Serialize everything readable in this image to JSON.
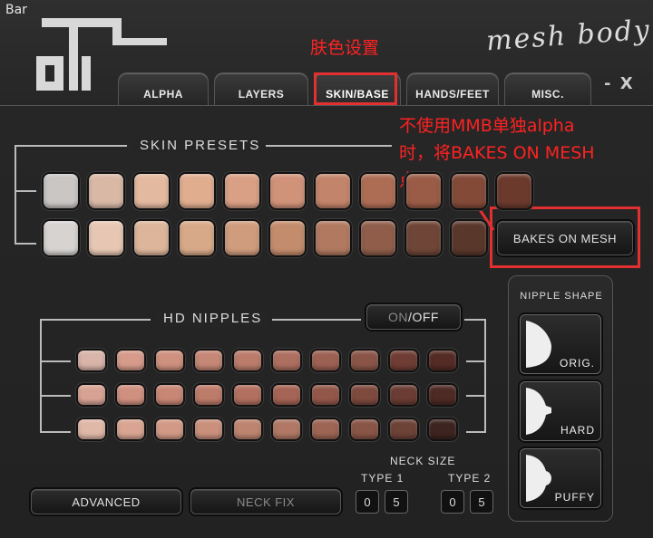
{
  "window": {
    "title": "Bar"
  },
  "brand": {
    "script_text": "mesh body"
  },
  "tabs": [
    {
      "label": "ALPHA"
    },
    {
      "label": "LAYERS"
    },
    {
      "label": "SKIN/BASE"
    },
    {
      "label": "HANDS/FEET"
    },
    {
      "label": "MISC."
    }
  ],
  "window_controls": {
    "minimize": "-",
    "close": "X"
  },
  "annotations": {
    "tab_note": "肤色设置",
    "bom_note_line1": "不使用MMB单独alpha",
    "bom_note_line2": "时，将BAKES ON MESH",
    "bom_note_line3": "点亮",
    "color": "#e23030"
  },
  "skin_presets": {
    "label": "SKIN PRESETS",
    "row1": [
      "#c9c6c4",
      "#d9b8a6",
      "#e3b99f",
      "#e0ad8f",
      "#d9a085",
      "#d09279",
      "#c2846a",
      "#ad6d55",
      "#9a5c46",
      "#834a38",
      "#6b3a2c"
    ],
    "row2": [
      "#d6d3d1",
      "#e7c7b4",
      "#dcb59b",
      "#d7a988",
      "#cf9c7d",
      "#c38c6d",
      "#b07960",
      "#8f5d4a",
      "#6e4536",
      "#5a372b"
    ],
    "bakes_on_mesh_label": "BAKES ON MESH"
  },
  "hd_nipples": {
    "label": "HD NIPPLES",
    "toggle_on": "ON",
    "toggle_sep": "/",
    "toggle_off": "OFF",
    "rows": [
      [
        "#d9b4a8",
        "#d69b8a",
        "#cf917f",
        "#c58776",
        "#bb7c6c",
        "#ad6f60",
        "#9c6153",
        "#8a5548",
        "#6f3d33",
        "#552b25"
      ],
      [
        "#d7a294",
        "#cf9080",
        "#c88675",
        "#bd7b6a",
        "#b27060",
        "#a56455",
        "#93574a",
        "#7e4a3e",
        "#6a3c33",
        "#4e2a24"
      ],
      [
        "#e0b8a8",
        "#d9a592",
        "#d29a86",
        "#c9907c",
        "#bd8470",
        "#b07865",
        "#9c6554",
        "#885546",
        "#6d4237",
        "#3d2420"
      ]
    ]
  },
  "nipple_shape": {
    "label": "NIPPLE SHAPE",
    "options": [
      "ORIG.",
      "HARD",
      "PUFFY"
    ]
  },
  "neck_size": {
    "label": "NECK SIZE",
    "type1": {
      "label": "TYPE 1",
      "digits": [
        "0",
        "5"
      ]
    },
    "type2": {
      "label": "TYPE 2",
      "digits": [
        "0",
        "5"
      ]
    }
  },
  "bottom_buttons": {
    "advanced": "ADVANCED",
    "neck_fix": "NECK FIX"
  }
}
